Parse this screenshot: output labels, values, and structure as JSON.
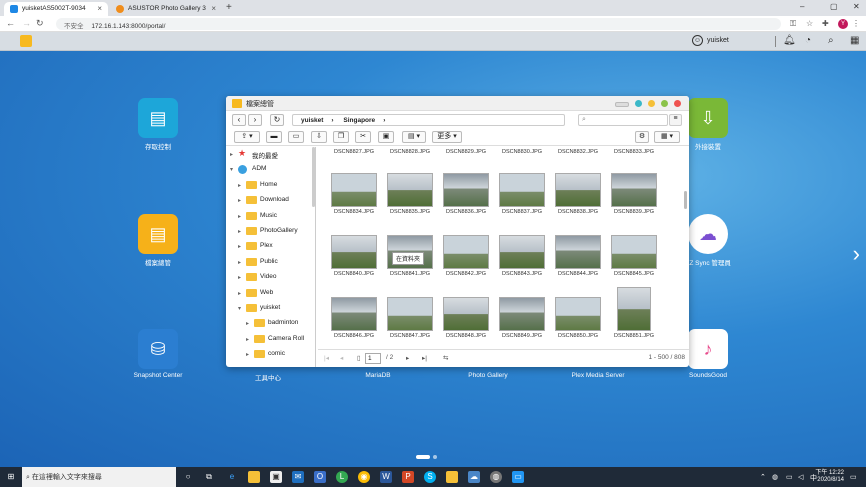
{
  "browser": {
    "tabs": [
      {
        "title": "yuisketAS5002T-9034",
        "active": true
      },
      {
        "title": "ASUSTOR Photo Gallery 3",
        "active": false
      }
    ],
    "security_label": "不安全",
    "url": "172.16.1.143:8000/portal/",
    "profile_initial": "Y"
  },
  "adm_bar": {
    "user": "yuisket"
  },
  "desktop": {
    "icons": [
      {
        "label": "存取控制",
        "color": "#1da6d9",
        "glyph": "▤"
      },
      {
        "label": "檔案總管",
        "color": "#f6b119",
        "glyph": "▤"
      },
      {
        "label": "Snapshot Center",
        "color": "#2b7ed1",
        "glyph": "⛁"
      },
      {
        "label": "外接裝置",
        "color": "#7ab837",
        "glyph": "⇩"
      },
      {
        "label": "EZ Sync 管理員",
        "color": "#7b4fd1",
        "glyph": "☁"
      },
      {
        "label": "SoundsGood",
        "color": "#e84b8c",
        "glyph": "♪"
      },
      {
        "label": "工具中心",
        "color": "#e07a1f",
        "glyph": ""
      },
      {
        "label": "MariaDB",
        "color": "#6a7d99",
        "glyph": ""
      },
      {
        "label": "Photo Gallery",
        "color": "#f08d1c",
        "glyph": ""
      },
      {
        "label": "Plex Media Server",
        "color": "#333333",
        "glyph": ""
      }
    ]
  },
  "file_window": {
    "title": "檔案總管",
    "breadcrumb": [
      "yuisket",
      "Singapore"
    ],
    "search_placeholder": "",
    "toolbar": {
      "upload": "⇪",
      "more_label": "更多",
      "tooltip": "在資料夾"
    },
    "tree": [
      {
        "label": "我的最愛",
        "level": 0,
        "arrow": "▸",
        "kind": "star"
      },
      {
        "label": "ADM",
        "level": 0,
        "arrow": "▾",
        "kind": "adm"
      },
      {
        "label": "Home",
        "level": 1,
        "arrow": "▸",
        "kind": "folder"
      },
      {
        "label": "Download",
        "level": 1,
        "arrow": "▸",
        "kind": "folder"
      },
      {
        "label": "Music",
        "level": 1,
        "arrow": "▸",
        "kind": "folder"
      },
      {
        "label": "PhotoGallery",
        "level": 1,
        "arrow": "▸",
        "kind": "folder"
      },
      {
        "label": "Plex",
        "level": 1,
        "arrow": "▸",
        "kind": "folder"
      },
      {
        "label": "Public",
        "level": 1,
        "arrow": "▸",
        "kind": "folder"
      },
      {
        "label": "Video",
        "level": 1,
        "arrow": "▸",
        "kind": "folder"
      },
      {
        "label": "Web",
        "level": 1,
        "arrow": "▸",
        "kind": "folder"
      },
      {
        "label": "yuisket",
        "level": 1,
        "arrow": "▾",
        "kind": "folder"
      },
      {
        "label": "badminton",
        "level": 2,
        "arrow": "▸",
        "kind": "folder"
      },
      {
        "label": "Camera Roll",
        "level": 2,
        "arrow": "▸",
        "kind": "folder"
      },
      {
        "label": "comic",
        "level": 2,
        "arrow": "▸",
        "kind": "folder"
      }
    ],
    "top_row": [
      "DSCN8827.JPG",
      "DSCN8828.JPG",
      "DSCN8829.JPG",
      "DSCN8830.JPG",
      "DSCN8832.JPG",
      "DSCN8833.JPG"
    ],
    "rows": [
      [
        "DSCN8834.JPG",
        "DSCN8835.JPG",
        "DSCN8836.JPG",
        "DSCN8837.JPG",
        "DSCN8838.JPG",
        "DSCN8839.JPG"
      ],
      [
        "DSCN8840.JPG",
        "DSCN8841.JPG",
        "DSCN8842.JPG",
        "DSCN8843.JPG",
        "DSCN8844.JPG",
        "DSCN8845.JPG"
      ],
      [
        "DSCN8846.JPG",
        "DSCN8847.JPG",
        "DSCN8848.JPG",
        "DSCN8849.JPG",
        "DSCN8850.JPG",
        "DSCN8851.JPG"
      ]
    ],
    "pagination": {
      "current": "1",
      "total": "/ 2",
      "range": "1 - 500 / 808"
    }
  },
  "taskbar": {
    "search_placeholder": "在這裡輸入文字來搜尋",
    "time": "下午 12:22",
    "date": "2020/8/14"
  }
}
